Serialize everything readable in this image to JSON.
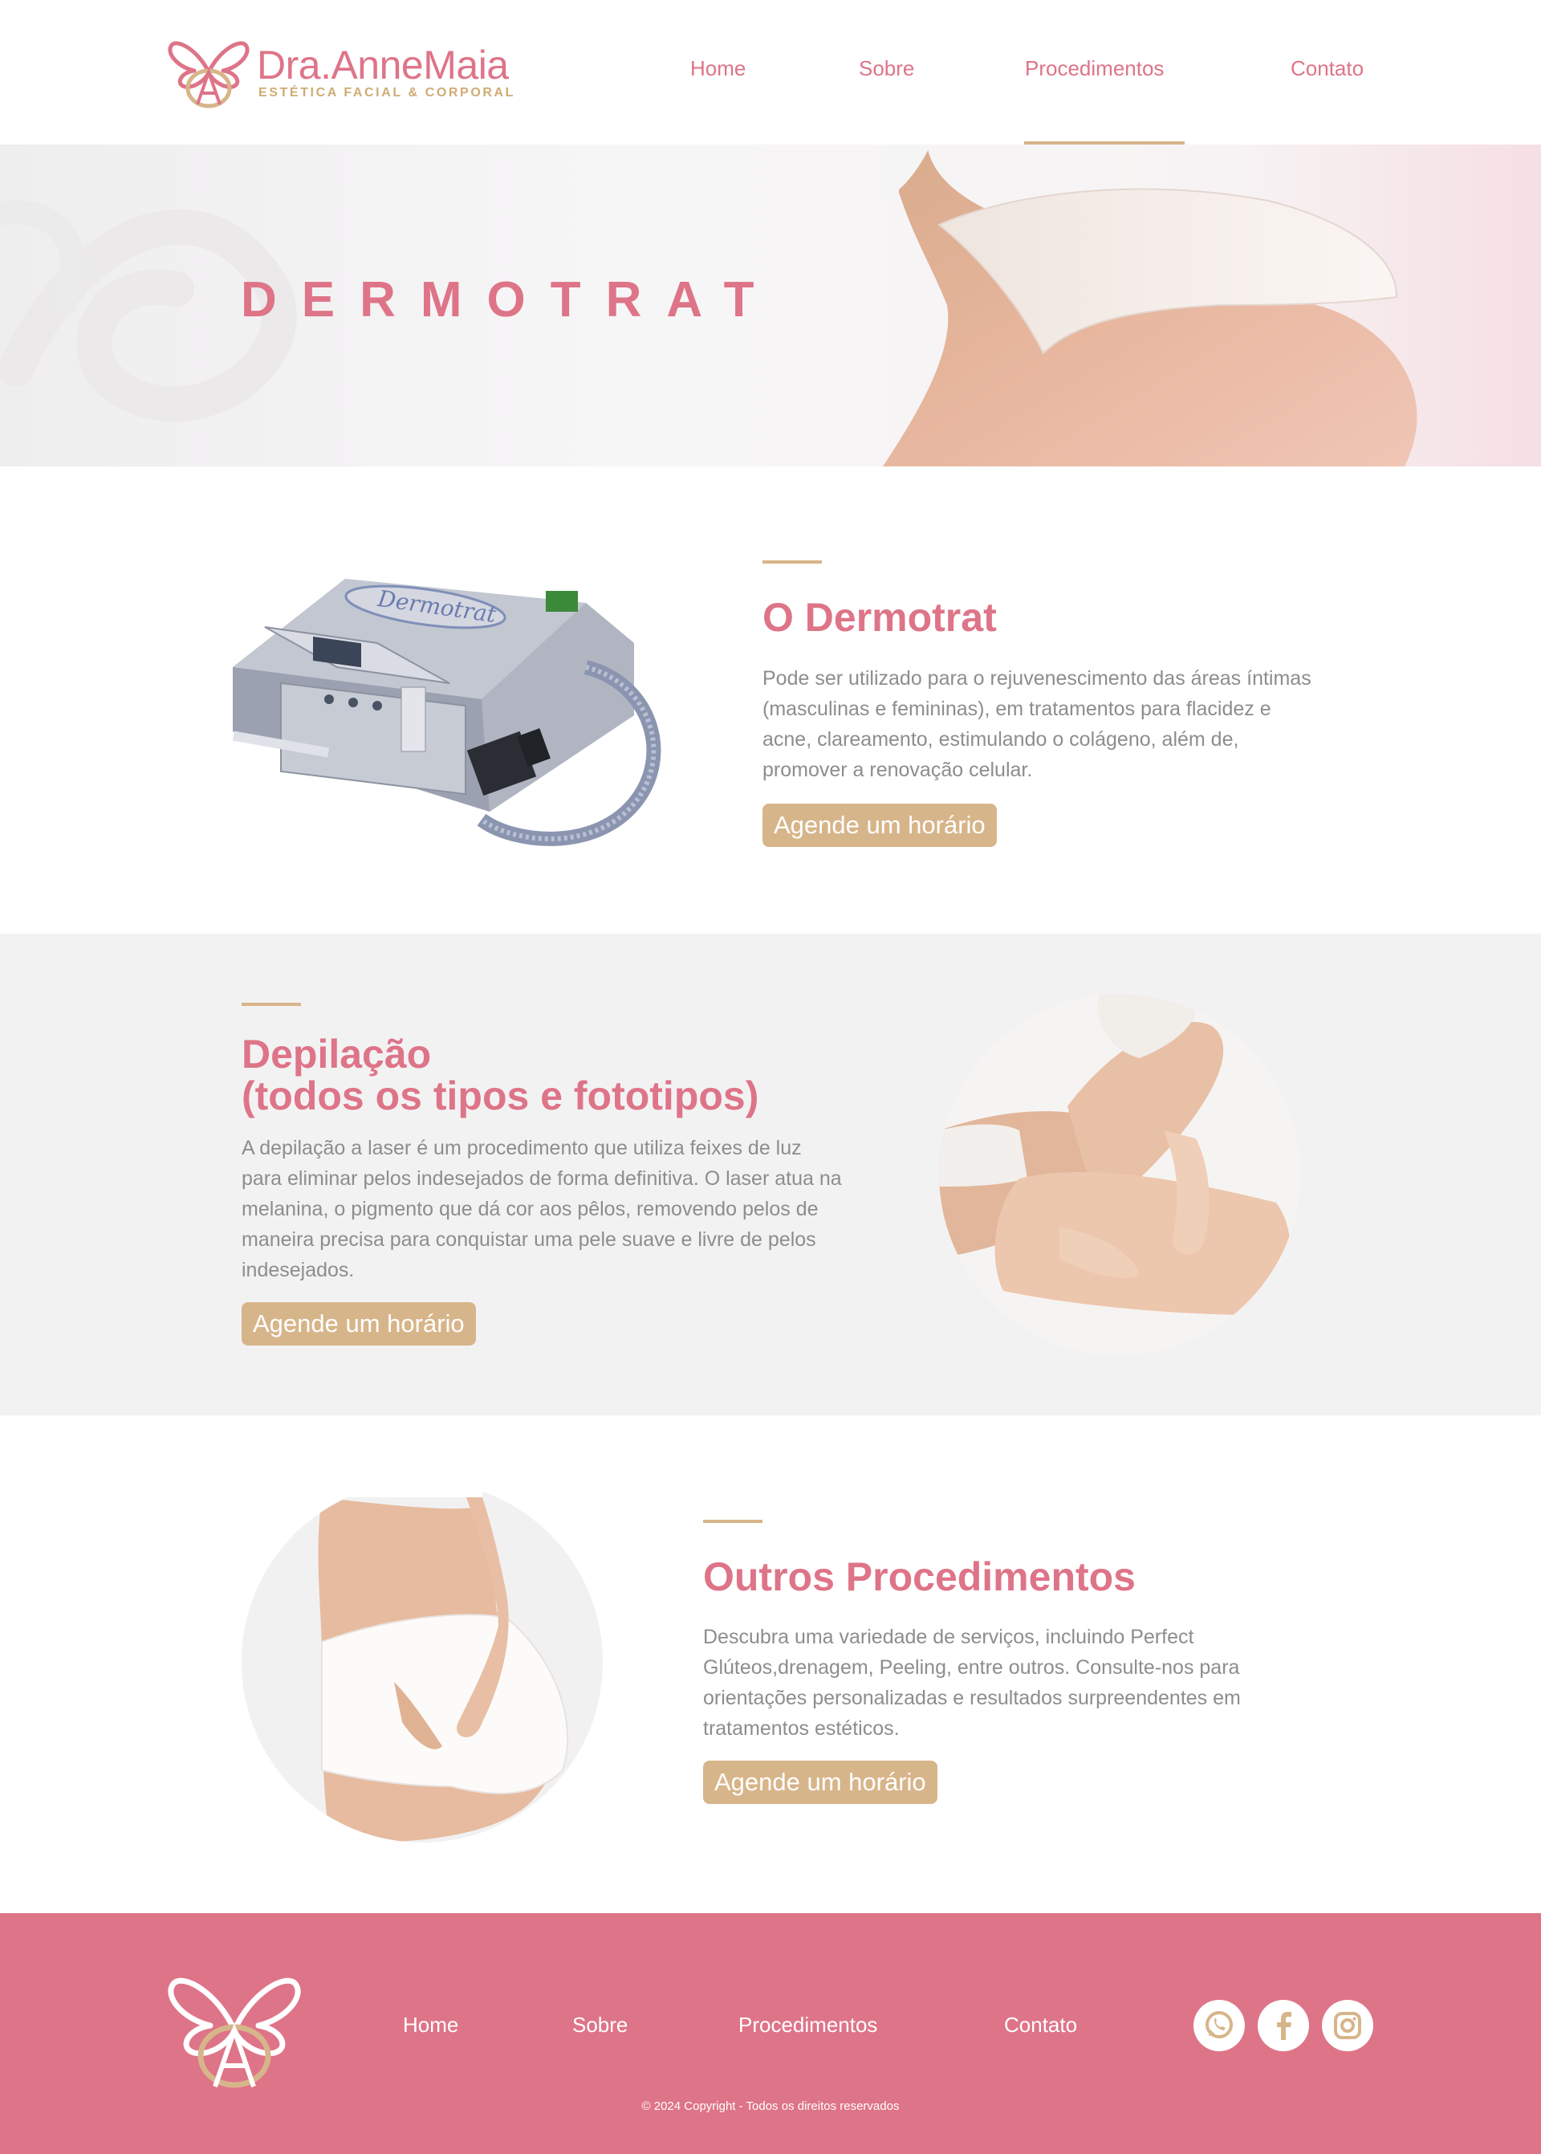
{
  "brand": {
    "name": "Dra.AnneMaia",
    "tagline": "ESTÉTICA FACIAL & CORPORAL",
    "primary_color": "#de7488",
    "accent_color": "#d7b58a"
  },
  "nav": {
    "items": [
      "Home",
      "Sobre",
      "Procedimentos",
      "Contato"
    ],
    "active": "Procedimentos"
  },
  "hero": {
    "title": "DERMOTRAT"
  },
  "sections": [
    {
      "title": "O Dermotrat",
      "text": "Pode ser utilizado para o rejuvenescimento das áreas íntimas (masculinas e femininas), em tratamentos para flacidez e acne, clareamento, estimulando o colágeno, além de, promover a renovação celular.",
      "button": "Agende um horário",
      "device_label": "Dermotrat"
    },
    {
      "title_line1": "Depilação",
      "title_line2": "(todos os tipos e fototipos)",
      "text": "A depilação a laser é um procedimento que utiliza feixes de luz para eliminar pelos indesejados de forma definitiva. O laser atua na melanina, o pigmento que dá cor aos pêlos, removendo pelos de maneira precisa para conquistar uma pele suave e livre de pelos indesejados.",
      "button": "Agende um horário"
    },
    {
      "title": "Outros Procedimentos",
      "text": "Descubra uma variedade de serviços, incluindo Perfect Glúteos,drenagem, Peeling, entre outros. Consulte-nos para orientações personalizadas e resultados surpreendentes em tratamentos estéticos.",
      "button": "Agende um horário"
    }
  ],
  "footer": {
    "nav": [
      "Home",
      "Sobre",
      "Procedimentos",
      "Contato"
    ],
    "social": [
      "whatsapp-icon",
      "facebook-icon",
      "instagram-icon"
    ],
    "copyright": "© 2024 Copyright - Todos os direitos reservados"
  }
}
